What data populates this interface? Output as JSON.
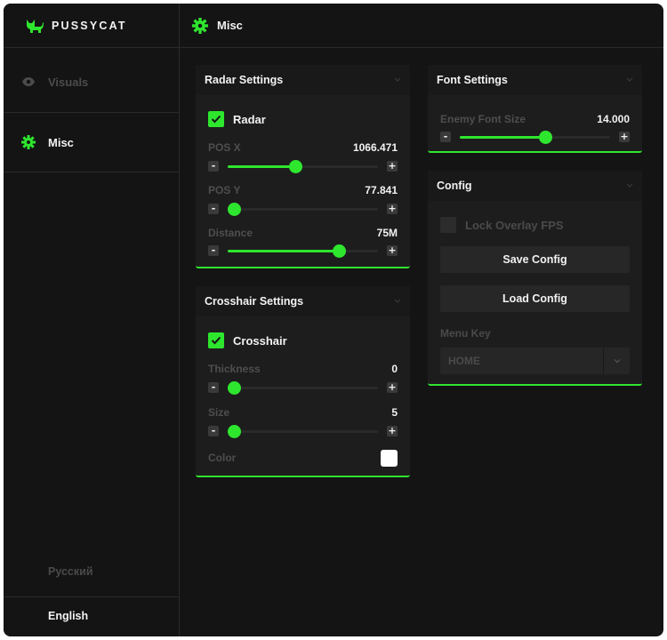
{
  "brand": {
    "name": "PUSSYCAT",
    "logo_icon": "cat-icon"
  },
  "sidebar": {
    "items": [
      {
        "label": "Visuals",
        "icon": "eye-icon",
        "active": false
      },
      {
        "label": "Misc",
        "icon": "gear-icon",
        "active": true
      }
    ],
    "languages": [
      {
        "label": "Русский",
        "active": false
      },
      {
        "label": "English",
        "active": true
      }
    ]
  },
  "header": {
    "title": "Misc",
    "icon": "gear-icon"
  },
  "colors": {
    "accent": "#2ee62e",
    "background": "#141414",
    "panel": "#1d1d1d"
  },
  "radar": {
    "title": "Radar Settings",
    "toggle": {
      "label": "Radar",
      "checked": true
    },
    "sliders": [
      {
        "label": "POS X",
        "value": "1066.471",
        "fill": 0.45
      },
      {
        "label": "POS Y",
        "value": "77.841",
        "fill": 0.04
      },
      {
        "label": "Distance",
        "value": "75M",
        "fill": 0.74
      }
    ]
  },
  "crosshair": {
    "title": "Crosshair Settings",
    "toggle": {
      "label": "Crosshair",
      "checked": true
    },
    "sliders": [
      {
        "label": "Thickness",
        "value": "0",
        "fill": 0.04
      },
      {
        "label": "Size",
        "value": "5",
        "fill": 0.04
      }
    ],
    "color": {
      "label": "Color",
      "value": "#ffffff"
    }
  },
  "font": {
    "title": "Font Settings",
    "sliders": [
      {
        "label": "Enemy Font Size",
        "value": "14.000",
        "fill": 0.57
      }
    ]
  },
  "config": {
    "title": "Config",
    "toggle": {
      "label": "Lock Overlay FPS",
      "checked": false
    },
    "save_label": "Save Config",
    "load_label": "Load Config",
    "menu_key_label": "Menu Key",
    "menu_key_value": "HOME"
  },
  "stepper": {
    "minus": "-",
    "plus": "+"
  }
}
